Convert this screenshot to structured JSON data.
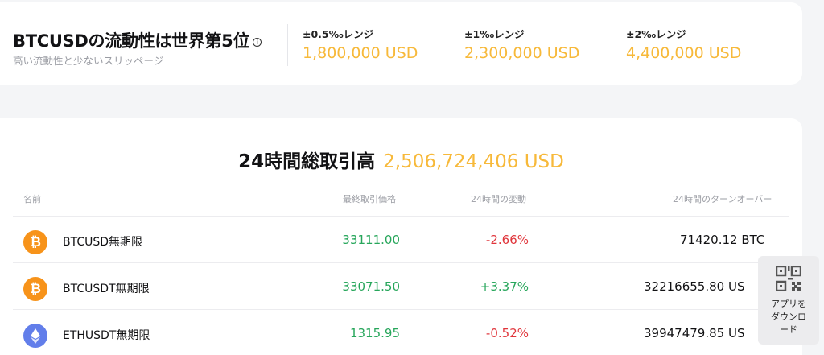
{
  "liquidity": {
    "title": "BTCUSDの流動性は世界第5位",
    "subtitle": "高い流動性と少ないスリッページ",
    "ranges": [
      {
        "label": "±0.5‰レンジ",
        "value": "1,800,000 USD"
      },
      {
        "label": "±1‰レンジ",
        "value": "2,300,000 USD"
      },
      {
        "label": "±2‰レンジ",
        "value": "4,400,000 USD"
      }
    ]
  },
  "volume": {
    "label": "24時間総取引高",
    "value": "2,506,724,406 USD"
  },
  "table": {
    "headers": {
      "name": "名前",
      "price": "最終取引価格",
      "change": "24時間の変動",
      "turnover": "24時間のターンオーバー"
    },
    "rows": [
      {
        "coin_icon": "bitcoin-icon",
        "name": "BTCUSD無期限",
        "price": "33111.00",
        "change": "-2.66%",
        "change_dir": "down",
        "turnover": "71420.12  BTC"
      },
      {
        "coin_icon": "bitcoin-icon",
        "name": "BTCUSDT無期限",
        "price": "33071.50",
        "change": "+3.37%",
        "change_dir": "up",
        "turnover": "32216655.80  US"
      },
      {
        "coin_icon": "ethereum-icon",
        "name": "ETHUSDT無期限",
        "price": "1315.95",
        "change": "-0.52%",
        "change_dir": "down",
        "turnover": "39947479.85  US"
      }
    ]
  },
  "qr_widget": {
    "icon": "qr-code-icon",
    "text": "アプリを\nダウンロ\nード"
  },
  "colors": {
    "accent": "#f7b93a",
    "positive": "#27a65b",
    "negative": "#e0353b",
    "bitcoin": "#f7931a",
    "ethereum": "#627eea"
  }
}
